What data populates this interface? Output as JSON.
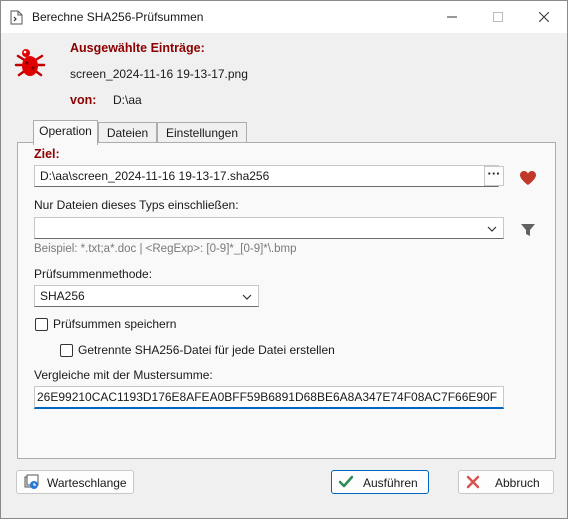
{
  "window": {
    "title": "Berechne SHA256-Prüfsummen",
    "icon": "file-icon"
  },
  "header": {
    "selected_label": "Ausgewählte Einträge:",
    "selected_value": "screen_2024-11-16 19-13-17.png",
    "from_label": "von:",
    "from_value": "D:\\aa",
    "app_icon": "ladybug-icon"
  },
  "tabs": [
    {
      "label": "Operation",
      "active": true
    },
    {
      "label": "Dateien",
      "active": false
    },
    {
      "label": "Einstellungen",
      "active": false
    }
  ],
  "operation": {
    "target_label": "Ziel:",
    "target_value": "D:\\aa\\screen_2024-11-16 19-13-17.sha256",
    "browse_label": "···",
    "filetypes_label": "Nur Dateien dieses Typs einschließen:",
    "filetypes_value": "",
    "filetypes_hint": "Beispiel: *.txt;a*.doc | <RegExp>: [0-9]*_[0-9]*\\.bmp",
    "method_label": "Prüfsummenmethode:",
    "method_value": "SHA256",
    "save_checksums_label": "Prüfsummen speichern",
    "save_checksums_checked": false,
    "separate_file_label": "Getrennte SHA256-Datei für jede Datei erstellen",
    "separate_file_checked": false,
    "compare_label": "Vergleiche mit der Mustersumme:",
    "compare_value": "26E99210CAC1193D176E8AFEA0BFF59B6891D68BE6A8A347E74F08AC7F66E90F"
  },
  "buttons": {
    "queue_label": "Warteschlange",
    "run_label": "Ausführen",
    "cancel_label": "Abbruch"
  },
  "colors": {
    "accent": "#0067c0",
    "label_red": "#8b0000",
    "heart": "#c0392b",
    "run_check": "#2e8b57",
    "cancel_x": "#d9534f"
  }
}
